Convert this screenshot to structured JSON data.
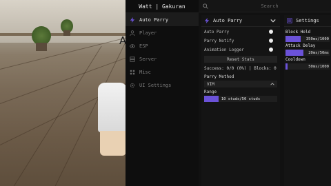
{
  "window": {
    "title": "Watt | Gakuran"
  },
  "background_glyph": "A",
  "sidebar": {
    "items": [
      {
        "label": "Auto Parry",
        "icon": "bolt-icon",
        "active": true
      },
      {
        "label": "Player",
        "icon": "user-icon",
        "active": false
      },
      {
        "label": "ESP",
        "icon": "eye-icon",
        "active": false
      },
      {
        "label": "Server",
        "icon": "server-icon",
        "active": false
      },
      {
        "label": "Misc",
        "icon": "grid-icon",
        "active": false
      },
      {
        "label": "UI Settings",
        "icon": "gear-icon",
        "active": false
      }
    ]
  },
  "search": {
    "placeholder": "Search"
  },
  "auto_parry_panel": {
    "title": "Auto Parry",
    "toggles": [
      {
        "label": "Auto Parry",
        "on": true
      },
      {
        "label": "Parry Notify",
        "on": true
      },
      {
        "label": "Animation Logger",
        "on": true
      }
    ],
    "reset_button": "Reset Stats",
    "stats": "Success: 0/0 (0%) | Blocks: 0",
    "parry_method": {
      "label": "Parry Method",
      "value": "VIM"
    },
    "range": {
      "label": "Range",
      "text": "10 studs/50 studs",
      "fraction": 0.2
    }
  },
  "settings_panel": {
    "title": "Settings",
    "sliders": [
      {
        "label": "Block Hold",
        "text": "350ms/1000",
        "fraction": 0.35
      },
      {
        "label": "Attack Delay",
        "text": "20ms/50ms",
        "fraction": 0.4
      },
      {
        "label": "Cooldown",
        "text": "50ms/1000",
        "fraction": 0.05
      }
    ]
  },
  "colors": {
    "accent": "#6b52d8",
    "sidebar_bg": "#0e0e0e",
    "panel_bg": "#141414"
  }
}
